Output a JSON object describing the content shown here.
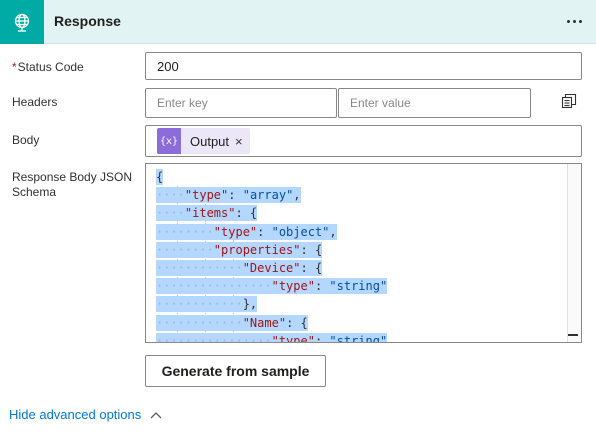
{
  "header": {
    "title": "Response",
    "icon": "globe-icon",
    "more_icon": "more-dots-icon",
    "color": "#00aba5"
  },
  "status_code": {
    "label": "Status Code",
    "required_mark": "*",
    "value": "200"
  },
  "headers": {
    "label": "Headers",
    "key_placeholder": "Enter key",
    "value_placeholder": "Enter value",
    "copy_icon": "copy-icon"
  },
  "body": {
    "label": "Body",
    "token": {
      "label": "Output",
      "icon_text": "{x}",
      "close": "×",
      "color": "#8c6cd8"
    }
  },
  "schema": {
    "label": "Response Body JSON Schema",
    "lines": [
      {
        "indent": 0,
        "parts": [
          {
            "t": "p",
            "v": "{"
          }
        ]
      },
      {
        "indent": 1,
        "parts": [
          {
            "t": "k",
            "v": "\"type\""
          },
          {
            "t": "p",
            "v": ": "
          },
          {
            "t": "s",
            "v": "\"array\""
          },
          {
            "t": "p",
            "v": ","
          }
        ]
      },
      {
        "indent": 1,
        "parts": [
          {
            "t": "k",
            "v": "\"items\""
          },
          {
            "t": "p",
            "v": ": {"
          }
        ]
      },
      {
        "indent": 2,
        "parts": [
          {
            "t": "k",
            "v": "\"type\""
          },
          {
            "t": "p",
            "v": ": "
          },
          {
            "t": "s",
            "v": "\"object\""
          },
          {
            "t": "p",
            "v": ","
          }
        ]
      },
      {
        "indent": 2,
        "parts": [
          {
            "t": "k",
            "v": "\"properties\""
          },
          {
            "t": "p",
            "v": ": {"
          }
        ]
      },
      {
        "indent": 3,
        "parts": [
          {
            "t": "k",
            "v": "\"Device\""
          },
          {
            "t": "p",
            "v": ": {"
          }
        ]
      },
      {
        "indent": 4,
        "parts": [
          {
            "t": "k",
            "v": "\"type\""
          },
          {
            "t": "p",
            "v": ": "
          },
          {
            "t": "s",
            "v": "\"string\""
          }
        ]
      },
      {
        "indent": 3,
        "parts": [
          {
            "t": "p",
            "v": "},"
          }
        ]
      },
      {
        "indent": 3,
        "parts": [
          {
            "t": "k",
            "v": "\"Name\""
          },
          {
            "t": "p",
            "v": ": {"
          }
        ]
      },
      {
        "indent": 4,
        "parts": [
          {
            "t": "k",
            "v": "\"type\""
          },
          {
            "t": "p",
            "v": ": "
          },
          {
            "t": "s",
            "v": "\"string\""
          }
        ]
      }
    ]
  },
  "generate_button": {
    "label": "Generate from sample"
  },
  "advanced": {
    "label": "Hide advanced options",
    "icon": "chevron-up-icon"
  }
}
